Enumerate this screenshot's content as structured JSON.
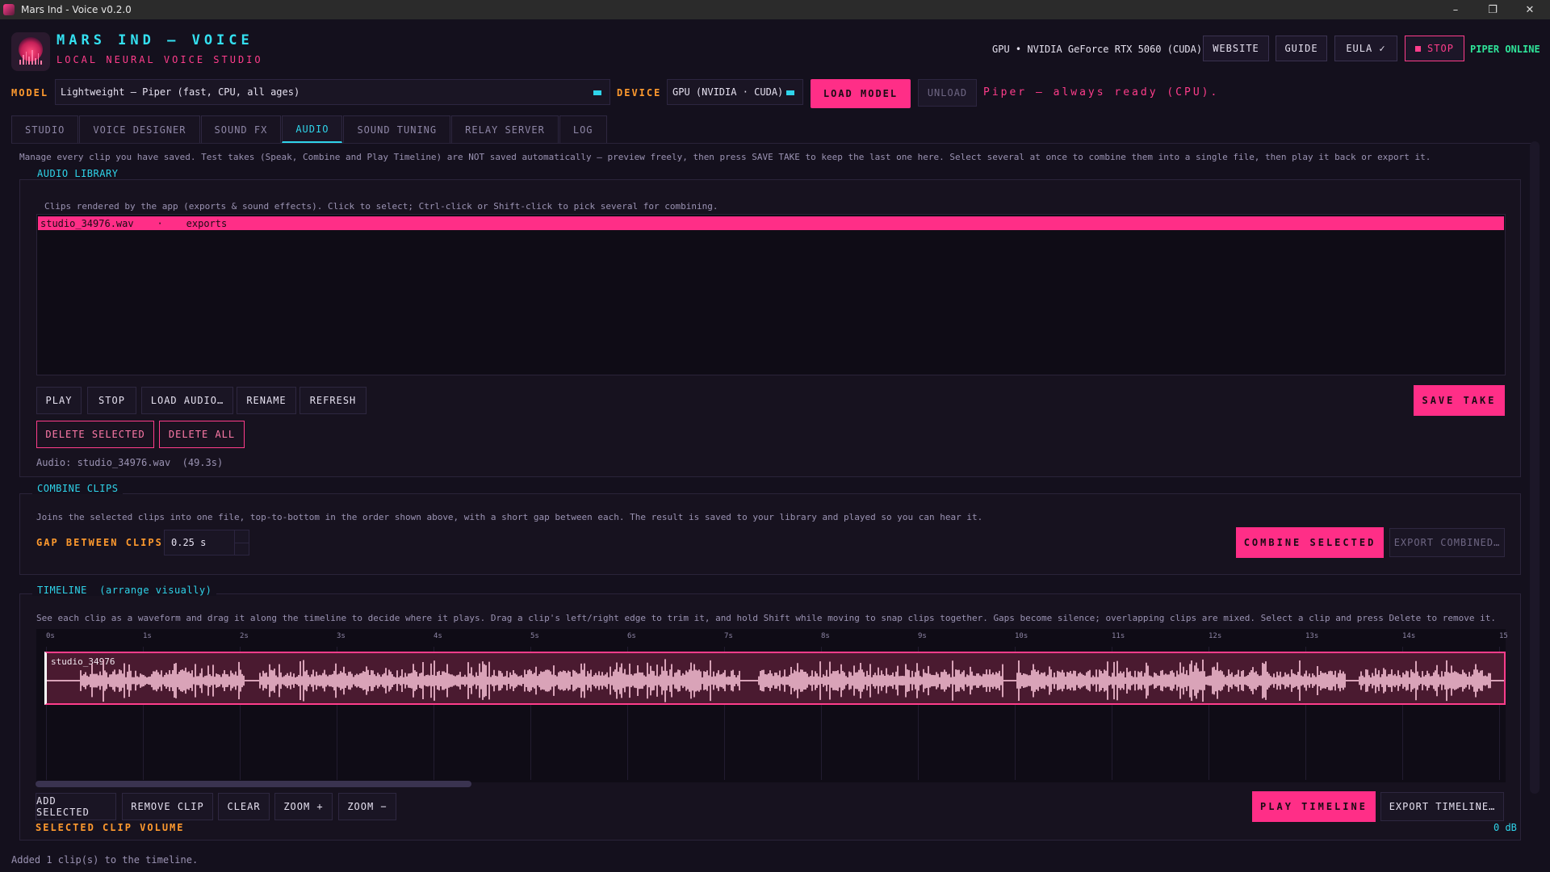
{
  "window": {
    "title": "Mars Ind - Voice v0.2.0",
    "controls": {
      "minimize": "–",
      "maximize": "❐",
      "close": "✕"
    }
  },
  "brand": {
    "title": "MARS IND — VOICE",
    "subtitle": "LOCAL NEURAL VOICE STUDIO"
  },
  "header": {
    "gpu_status": "GPU • NVIDIA GeForce RTX 5060 (CUDA)",
    "website": "WEBSITE",
    "guide": "GUIDE",
    "eula": "EULA ✓",
    "stop": "STOP",
    "engine_status": "PIPER ONLINE"
  },
  "model_row": {
    "model_label": "MODEL",
    "model_value": "Lightweight — Piper  (fast, CPU, all ages)",
    "device_label": "DEVICE",
    "device_value": "GPU (NVIDIA · CUDA)",
    "load_model": "LOAD MODEL",
    "unload": "UNLOAD",
    "status": "Piper — always ready (CPU)."
  },
  "tabs": [
    {
      "label": "STUDIO",
      "active": false
    },
    {
      "label": "VOICE DESIGNER",
      "active": false
    },
    {
      "label": "SOUND FX",
      "active": false
    },
    {
      "label": "AUDIO",
      "active": true
    },
    {
      "label": "SOUND TUNING",
      "active": false
    },
    {
      "label": "RELAY SERVER",
      "active": false
    },
    {
      "label": "LOG",
      "active": false
    }
  ],
  "intro": "Manage every clip you have saved. Test takes (Speak, Combine and Play Timeline) are NOT saved automatically — preview freely, then press SAVE TAKE to keep the last one here. Select several at once to combine them into a single file, then play it back or export it.",
  "library": {
    "title": "AUDIO LIBRARY",
    "description": "Clips rendered by the app (exports & sound effects). Click to select; Ctrl-click or Shift-click to pick several for combining.",
    "items": [
      {
        "name": "studio_34976.wav",
        "separator": "·",
        "folder": "exports"
      }
    ],
    "buttons": {
      "play": "PLAY",
      "stop": "STOP",
      "load": "LOAD AUDIO…",
      "rename": "RENAME",
      "refresh": "REFRESH",
      "save_take": "SAVE TAKE",
      "delete_selected": "DELETE SELECTED",
      "delete_all": "DELETE ALL"
    },
    "current_audio": "Audio: studio_34976.wav  (49.3s)"
  },
  "combine": {
    "title": "COMBINE CLIPS",
    "description": "Joins the selected clips into one file, top-to-bottom in the order shown above, with a short gap between each. The result is saved to your library and played so you can hear it.",
    "gap_label": "GAP BETWEEN CLIPS",
    "gap_value": "0.25 s",
    "combine_selected": "COMBINE SELECTED",
    "export_combined": "EXPORT COMBINED…"
  },
  "timeline": {
    "title": "TIMELINE",
    "title_sub": "(arrange visually)",
    "description": "See each clip as a waveform and drag it along the timeline to decide where it plays. Drag a clip's left/right edge to trim it, and hold Shift while moving to snap clips together. Gaps become silence; overlapping clips are mixed. Select a clip and press Delete to remove it.",
    "ticks": [
      "0s",
      "1s",
      "2s",
      "3s",
      "4s",
      "5s",
      "6s",
      "7s",
      "8s",
      "9s",
      "10s",
      "11s",
      "12s",
      "13s",
      "14s",
      "15"
    ],
    "clip_name": "studio_34976",
    "buttons": {
      "add_selected": "ADD SELECTED",
      "remove_clip": "REMOVE CLIP",
      "clear": "CLEAR",
      "zoom_in": "ZOOM +",
      "zoom_out": "ZOOM −",
      "play_timeline": "PLAY TIMELINE",
      "export_timeline": "EXPORT TIMELINE…"
    },
    "volume_label": "SELECTED CLIP VOLUME",
    "volume_value": "0 dB"
  },
  "status_bar": "Added 1 clip(s) to the timeline.",
  "colors": {
    "accent_pink": "#ff2e87",
    "accent_cyan": "#2fd4ea",
    "label_orange": "#ff9a2e",
    "online_green": "#2fe59a",
    "background": "#14101d",
    "waveform": "#d9a3b8"
  }
}
